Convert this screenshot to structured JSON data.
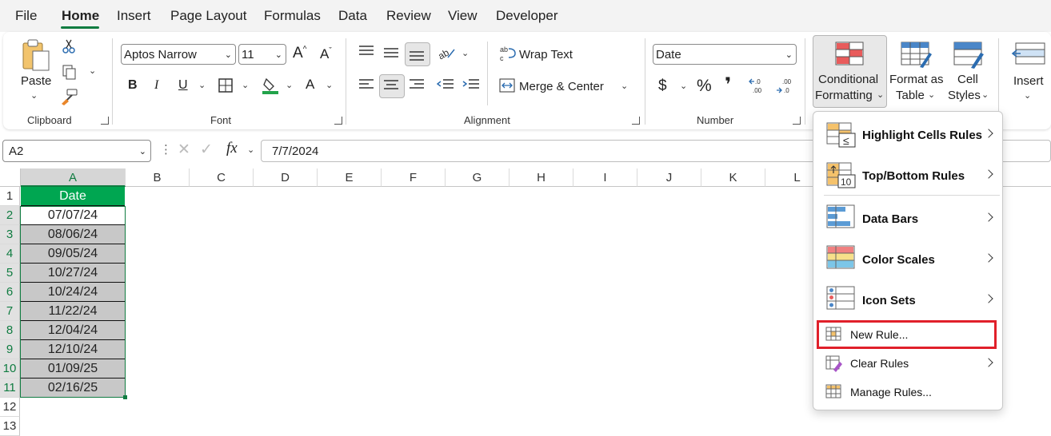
{
  "menu": {
    "tabs": [
      "File",
      "Home",
      "Insert",
      "Page Layout",
      "Formulas",
      "Data",
      "Review",
      "View",
      "Developer"
    ],
    "active": "Home"
  },
  "ribbon": {
    "clipboard": {
      "paste_label": "Paste",
      "group_label": "Clipboard"
    },
    "font": {
      "font_name": "Aptos Narrow",
      "font_size": "11",
      "group_label": "Font",
      "bold": "B",
      "italic": "I",
      "underline": "U"
    },
    "alignment": {
      "wrap_text": "Wrap Text",
      "merge_center": "Merge & Center",
      "group_label": "Alignment"
    },
    "number": {
      "format": "Date",
      "currency": "$",
      "percent": "%",
      "comma": "❜",
      "group_label": "Number"
    },
    "styles": {
      "conditional_formatting_line1": "Conditional",
      "conditional_formatting_line2": "Formatting",
      "format_as_table_line1": "Format as",
      "format_as_table_line2": "Table",
      "cell_styles_line1": "Cell",
      "cell_styles_line2": "Styles"
    },
    "cells": {
      "insert": "Insert"
    }
  },
  "formula_bar": {
    "name_box": "A2",
    "fx": "fx",
    "value": "7/7/2024"
  },
  "grid": {
    "columns": [
      "A",
      "B",
      "C",
      "D",
      "E",
      "F",
      "G",
      "H",
      "I",
      "J",
      "K",
      "L"
    ],
    "rows": [
      "1",
      "2",
      "3",
      "4",
      "5",
      "6",
      "7",
      "8",
      "9",
      "10",
      "11",
      "12",
      "13"
    ],
    "header_cell": "Date",
    "cells": [
      "07/07/24",
      "08/06/24",
      "09/05/24",
      "10/27/24",
      "10/24/24",
      "11/22/24",
      "12/04/24",
      "12/10/24",
      "01/09/25",
      "02/16/25"
    ]
  },
  "dropdown": {
    "items": [
      "Highlight Cells Rules",
      "Top/Bottom Rules",
      "Data Bars",
      "Color Scales",
      "Icon Sets",
      "New Rule...",
      "Clear Rules",
      "Manage Rules..."
    ],
    "highlighted": "New Rule...",
    "icon_ten": "10"
  },
  "colors": {
    "accent": "#107c41",
    "highlight_border": "#e0202a",
    "selection_fill": "#c8c8c8"
  }
}
